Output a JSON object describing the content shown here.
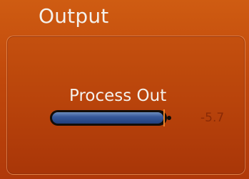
{
  "panel": {
    "title": "Output"
  },
  "meter": {
    "label": "Process Out",
    "value_text": "-5.7",
    "fill_fraction": 0.95,
    "fill_color": "#37599a",
    "marker_color": "#e9842a"
  },
  "colors": {
    "background": "#c0480b",
    "label_text": "#f4f1ec",
    "value_text": "#8a2a06"
  }
}
